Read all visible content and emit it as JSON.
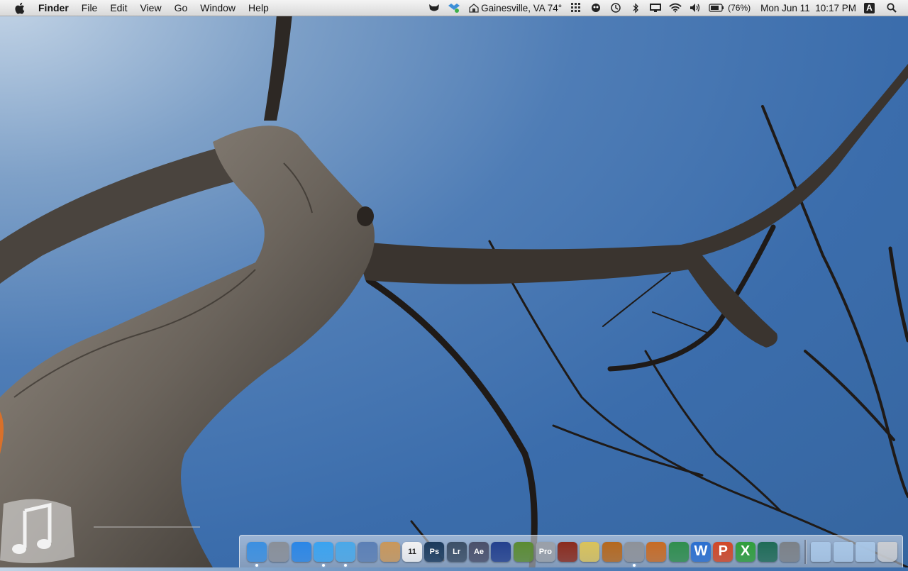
{
  "menubar": {
    "app_name": "Finder",
    "menus": [
      "File",
      "Edit",
      "View",
      "Go",
      "Window",
      "Help"
    ],
    "status": {
      "weather": "Gainesville, VA 74°",
      "battery": "(76%)",
      "datetime": "Mon Jun 11  10:17 PM",
      "input_source": "A"
    },
    "status_icons": [
      "cat-icon",
      "dropbox-icon",
      "weather-icon",
      "grid-icon",
      "eye-icon",
      "time-machine-icon",
      "bluetooth-icon",
      "display-icon",
      "wifi-icon",
      "volume-icon",
      "battery-icon",
      "input-source-icon",
      "spotlight-icon"
    ]
  },
  "desktop": {
    "music_widget_icon": "music-note-icon"
  },
  "dock": {
    "apps": [
      {
        "name": "Finder",
        "icon": "finder-icon",
        "color": "#3b8fe0",
        "running": true
      },
      {
        "name": "Launchpad",
        "icon": "launchpad-icon",
        "color": "#8a8f98",
        "running": false
      },
      {
        "name": "App Store",
        "icon": "app-store-icon",
        "color": "#2a86e6",
        "running": false
      },
      {
        "name": "iTunes",
        "icon": "itunes-icon",
        "color": "#3aa3f0",
        "running": true
      },
      {
        "name": "Safari",
        "icon": "safari-icon",
        "color": "#4aa8e8",
        "running": true
      },
      {
        "name": "Mail",
        "icon": "mail-icon",
        "color": "#5b7fb5",
        "running": false
      },
      {
        "name": "Address Book",
        "icon": "address-book-icon",
        "color": "#c9975a",
        "running": false
      },
      {
        "name": "iCal",
        "icon": "ical-icon",
        "color": "#f2f2f2",
        "running": false
      },
      {
        "name": "Photoshop",
        "icon": "photoshop-icon",
        "color": "#1b3a5c",
        "running": false
      },
      {
        "name": "Lightroom",
        "icon": "lightroom-icon",
        "color": "#3c4f66",
        "running": false
      },
      {
        "name": "After Effects",
        "icon": "after-effects-icon",
        "color": "#4a4f6a",
        "running": false
      },
      {
        "name": "Cinema 4D",
        "icon": "cinema-4d-icon",
        "color": "#23408e",
        "running": false
      },
      {
        "name": "Minecraft",
        "icon": "minecraft-icon",
        "color": "#5b8b32",
        "running": false
      },
      {
        "name": "Pro",
        "icon": "pro-icon",
        "color": "#9aa0a8",
        "running": false
      },
      {
        "name": "Photo Booth",
        "icon": "photo-booth-icon",
        "color": "#8b2b1d",
        "running": false
      },
      {
        "name": "iMovie",
        "icon": "imovie-icon",
        "color": "#d9c25a",
        "running": false
      },
      {
        "name": "GarageBand",
        "icon": "garageband-icon",
        "color": "#b5681e",
        "running": false
      },
      {
        "name": "System Preferences",
        "icon": "system-preferences-icon",
        "color": "#8e9299",
        "running": true
      },
      {
        "name": "Keynote",
        "icon": "keynote-icon",
        "color": "#c76b25",
        "running": false
      },
      {
        "name": "Numbers",
        "icon": "numbers-icon",
        "color": "#2f8e4d",
        "running": false
      },
      {
        "name": "Word",
        "icon": "word-icon",
        "color": "#2b6fd0",
        "running": false
      },
      {
        "name": "PowerPoint",
        "icon": "powerpoint-icon",
        "color": "#d24726",
        "running": false
      },
      {
        "name": "Excel",
        "icon": "excel-icon",
        "color": "#2f9e3b",
        "running": false
      },
      {
        "name": "Time Machine",
        "icon": "time-machine-dock-icon",
        "color": "#1f6b56",
        "running": false
      },
      {
        "name": "Activity Monitor",
        "icon": "activity-monitor-icon",
        "color": "#7c8187",
        "running": false
      }
    ],
    "stacks": [
      {
        "name": "Applications",
        "icon": "folder-applications-icon",
        "color": "#a8c6e6"
      },
      {
        "name": "Documents",
        "icon": "folder-documents-icon",
        "color": "#a8c6e6"
      },
      {
        "name": "Downloads",
        "icon": "folder-downloads-icon",
        "color": "#a8c6e6"
      },
      {
        "name": "Trash",
        "icon": "trash-icon",
        "color": "#c9ccd1"
      }
    ],
    "dock_glyphs": {
      "Photoshop": "Ps",
      "Lightroom": "Lr",
      "After Effects": "Ae",
      "Pro": "Pro",
      "Word": "W",
      "PowerPoint": "P",
      "Excel": "X",
      "iCal": "11"
    }
  }
}
